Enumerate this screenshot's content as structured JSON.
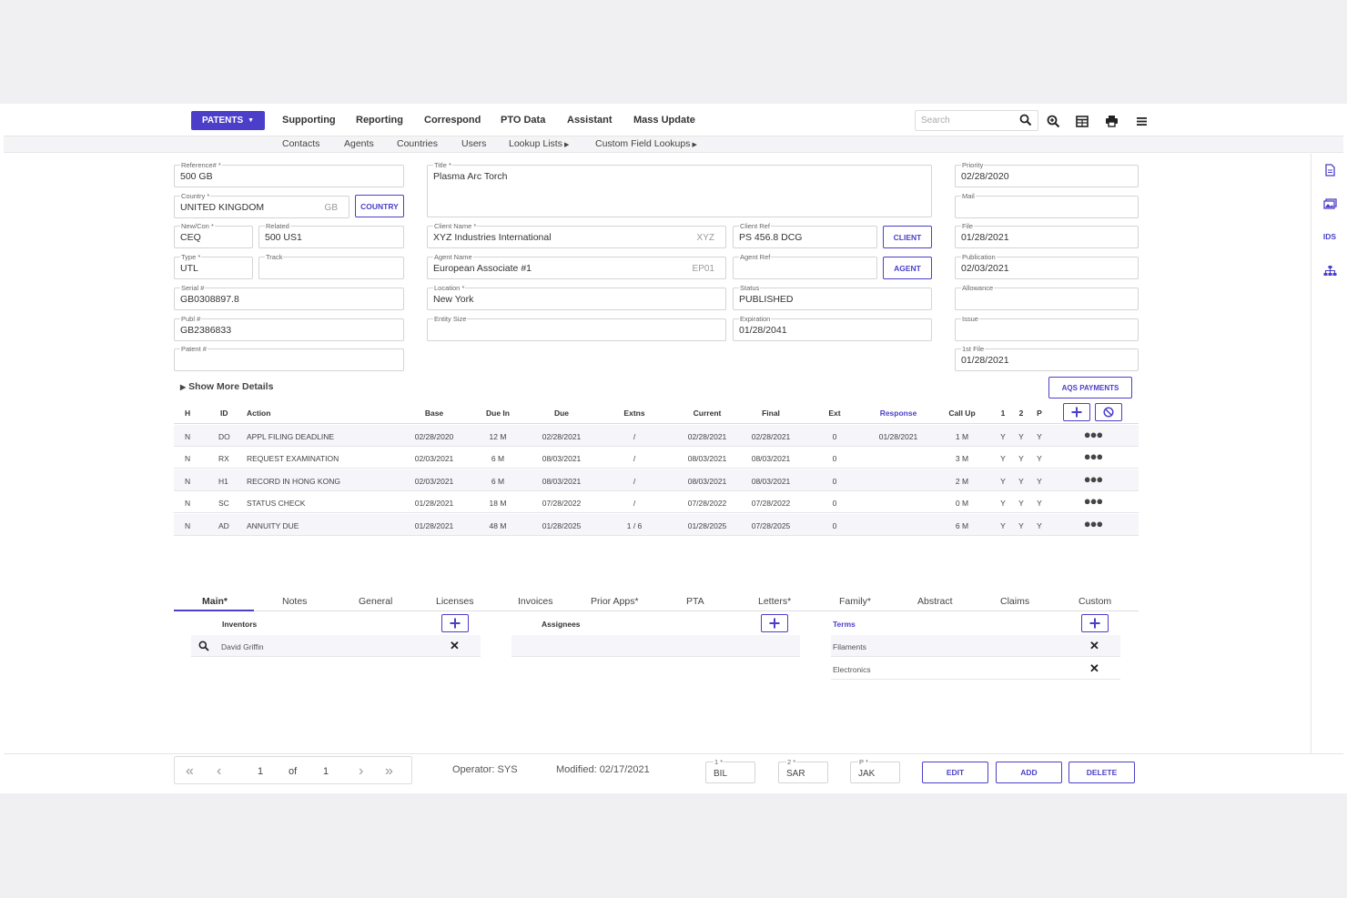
{
  "nav": {
    "patents_label": "PATENTS",
    "items": [
      "Supporting",
      "Reporting",
      "Correspond",
      "PTO Data",
      "Assistant",
      "Mass Update"
    ],
    "search_placeholder": "Search"
  },
  "subnav": {
    "items": [
      "Contacts",
      "Agents",
      "Countries",
      "Users",
      "Lookup Lists",
      "Custom Field Lookups"
    ]
  },
  "rail": {
    "ids_label": "IDS"
  },
  "form": {
    "reference": {
      "label": "Reference# *",
      "value": "500 GB"
    },
    "country": {
      "label": "Country *",
      "value": "UNITED KINGDOM",
      "code": "GB",
      "button": "COUNTRY"
    },
    "newcon": {
      "label": "New/Con *",
      "value": "CEQ"
    },
    "related": {
      "label": "Related",
      "value": "500 US1"
    },
    "type": {
      "label": "Type *",
      "value": "UTL"
    },
    "track": {
      "label": "Track",
      "value": ""
    },
    "serial": {
      "label": "Serial #",
      "value": "GB0308897.8"
    },
    "publ": {
      "label": "Publ #",
      "value": "GB2386833"
    },
    "patent": {
      "label": "Patent #",
      "value": ""
    },
    "title": {
      "label": "Title *",
      "value": "Plasma Arc Torch"
    },
    "client_name": {
      "label": "Client Name *",
      "value": "XYZ Industries International",
      "code": "XYZ"
    },
    "client_ref": {
      "label": "Client Ref",
      "value": "PS 456.8 DCG",
      "button": "CLIENT"
    },
    "agent_name": {
      "label": "Agent Name",
      "value": "European Associate #1",
      "code": "EP01"
    },
    "agent_ref": {
      "label": "Agent Ref",
      "value": "",
      "button": "AGENT"
    },
    "location": {
      "label": "Location *",
      "value": "New York"
    },
    "status": {
      "label": "Status",
      "value": "PUBLISHED"
    },
    "entity_size": {
      "label": "Entity Size",
      "value": ""
    },
    "expiration": {
      "label": "Expiration",
      "value": "01/28/2041"
    },
    "priority": {
      "label": "Priority",
      "value": "02/28/2020"
    },
    "mail": {
      "label": "Mail",
      "value": ""
    },
    "file": {
      "label": "File",
      "value": "01/28/2021"
    },
    "publication": {
      "label": "Publication",
      "value": "02/03/2021"
    },
    "allowance": {
      "label": "Allowance",
      "value": ""
    },
    "issue": {
      "label": "Issue",
      "value": ""
    },
    "first_file": {
      "label": "1st File",
      "value": "01/28/2021"
    }
  },
  "show_more": "Show More Details",
  "aqs_button": "AQS PAYMENTS",
  "table": {
    "headers": {
      "h": "H",
      "id": "ID",
      "action": "Action",
      "base": "Base",
      "due_in": "Due In",
      "due": "Due",
      "extns": "Extns",
      "current": "Current",
      "final": "Final",
      "ext": "Ext",
      "response": "Response",
      "call_up": "Call Up",
      "c1": "1",
      "c2": "2",
      "p": "P"
    },
    "rows": [
      {
        "h": "N",
        "id": "DO",
        "action": "APPL FILING DEADLINE",
        "base": "02/28/2020",
        "due_in": "12 M",
        "due": "02/28/2021",
        "extns": "/",
        "current": "02/28/2021",
        "final": "02/28/2021",
        "ext": "0",
        "response": "01/28/2021",
        "call_up": "1 M",
        "c1": "Y",
        "c2": "Y",
        "p": "Y"
      },
      {
        "h": "N",
        "id": "RX",
        "action": "REQUEST EXAMINATION",
        "base": "02/03/2021",
        "due_in": "6 M",
        "due": "08/03/2021",
        "extns": "/",
        "current": "08/03/2021",
        "final": "08/03/2021",
        "ext": "0",
        "response": "",
        "call_up": "3 M",
        "c1": "Y",
        "c2": "Y",
        "p": "Y"
      },
      {
        "h": "N",
        "id": "H1",
        "action": "RECORD IN HONG KONG",
        "base": "02/03/2021",
        "due_in": "6 M",
        "due": "08/03/2021",
        "extns": "/",
        "current": "08/03/2021",
        "final": "08/03/2021",
        "ext": "0",
        "response": "",
        "call_up": "2 M",
        "c1": "Y",
        "c2": "Y",
        "p": "Y"
      },
      {
        "h": "N",
        "id": "SC",
        "action": "STATUS CHECK",
        "base": "01/28/2021",
        "due_in": "18 M",
        "due": "07/28/2022",
        "extns": "/",
        "current": "07/28/2022",
        "final": "07/28/2022",
        "ext": "0",
        "response": "",
        "call_up": "0 M",
        "c1": "Y",
        "c2": "Y",
        "p": "Y"
      },
      {
        "h": "N",
        "id": "AD",
        "action": "ANNUITY DUE",
        "base": "01/28/2021",
        "due_in": "48 M",
        "due": "01/28/2025",
        "extns": "1 / 6",
        "current": "01/28/2025",
        "final": "07/28/2025",
        "ext": "0",
        "response": "",
        "call_up": "6 M",
        "c1": "Y",
        "c2": "Y",
        "p": "Y"
      }
    ]
  },
  "tabs": [
    "Main*",
    "Notes",
    "General",
    "Licenses",
    "Invoices",
    "Prior Apps*",
    "PTA",
    "Letters*",
    "Family*",
    "Abstract",
    "Claims",
    "Custom"
  ],
  "inventors": {
    "title": "Inventors",
    "items": [
      "David Griffin"
    ]
  },
  "assignees": {
    "title": "Assignees",
    "items": []
  },
  "terms": {
    "title": "Terms",
    "items": [
      "Filaments",
      "Electronics"
    ]
  },
  "footer": {
    "page_current": "1",
    "of_label": "of",
    "page_total": "1",
    "operator": "Operator: SYS",
    "modified": "Modified: 02/17/2021",
    "initials": [
      {
        "label": "1 *",
        "value": "BIL"
      },
      {
        "label": "2 *",
        "value": "SAR"
      },
      {
        "label": "P *",
        "value": "JAK"
      }
    ],
    "edit": "EDIT",
    "add": "ADD",
    "delete": "DELETE"
  },
  "colors": {
    "accent": "#4b3fc9",
    "row_alt": "#f5f5fa",
    "background": "#f0f0f2"
  }
}
